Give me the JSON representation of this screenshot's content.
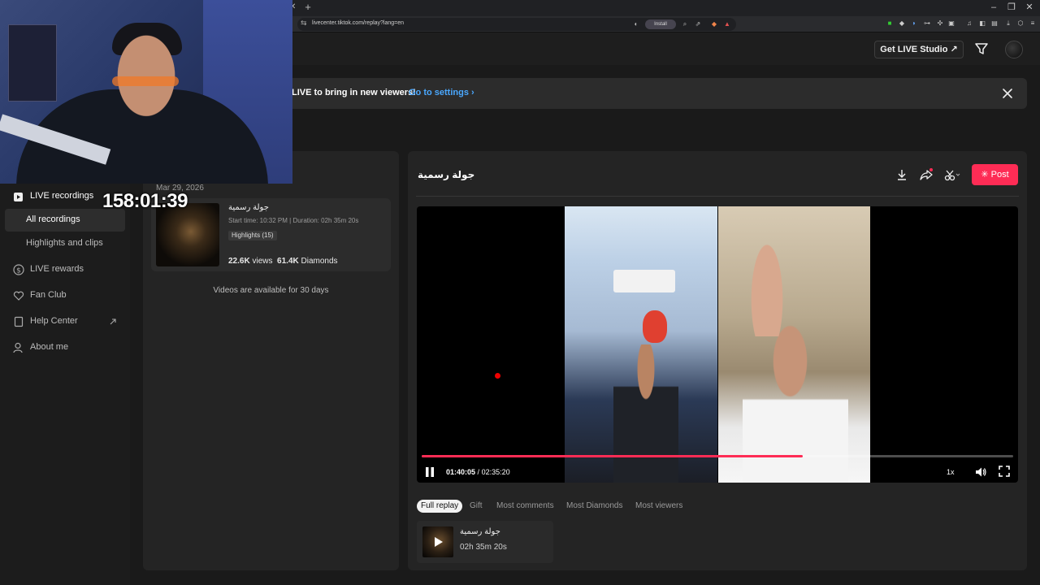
{
  "browser": {
    "url": "livecenter.tiktok.com/replay?lang=en",
    "install_label": "Install"
  },
  "header": {
    "get_live_studio_label": "Get LIVE Studio ↗"
  },
  "banner": {
    "text": "LIVE to bring in new viewers!",
    "link": "Go to settings ›"
  },
  "overlay": {
    "timer": "158:01:39"
  },
  "sidebar": {
    "items": [
      {
        "label": "LIVE recordings",
        "icon": "video-library-icon"
      },
      {
        "label": "All recordings"
      },
      {
        "label": "Highlights and clips"
      },
      {
        "label": "LIVE rewards",
        "icon": "dollar-icon"
      },
      {
        "label": "Fan Club",
        "icon": "heart-icon"
      },
      {
        "label": "Help Center",
        "icon": "book-icon",
        "trailing_icon": "external-link-icon"
      },
      {
        "label": "About me",
        "icon": "user-icon"
      }
    ]
  },
  "recordings": {
    "date": "Mar 29, 2026",
    "card": {
      "title": "جولة رسمية",
      "meta": "Start time: 10:32 PM | Duration: 02h 35m 20s",
      "highlights": "Highlights (15)",
      "views": "22.6K",
      "views_label": "views",
      "diamonds": "61.4K",
      "diamonds_label": "Diamonds"
    },
    "note": "Videos are available for 30 days"
  },
  "detail": {
    "title": "جولة رسمية",
    "post_label": "Post",
    "player": {
      "current_time": "01:40:05",
      "total_time": "02:35:20",
      "speed": "1x",
      "progress": 0.6448
    },
    "chips": [
      "Full replay",
      "Gift",
      "Most comments",
      "Most Diamonds",
      "Most viewers"
    ],
    "active_chip": "Full replay",
    "clip": {
      "title": "جولة رسمية",
      "duration": "02h 35m 20s"
    }
  },
  "colors": {
    "accent": "#fe2c55",
    "link": "#4aa8ff"
  }
}
